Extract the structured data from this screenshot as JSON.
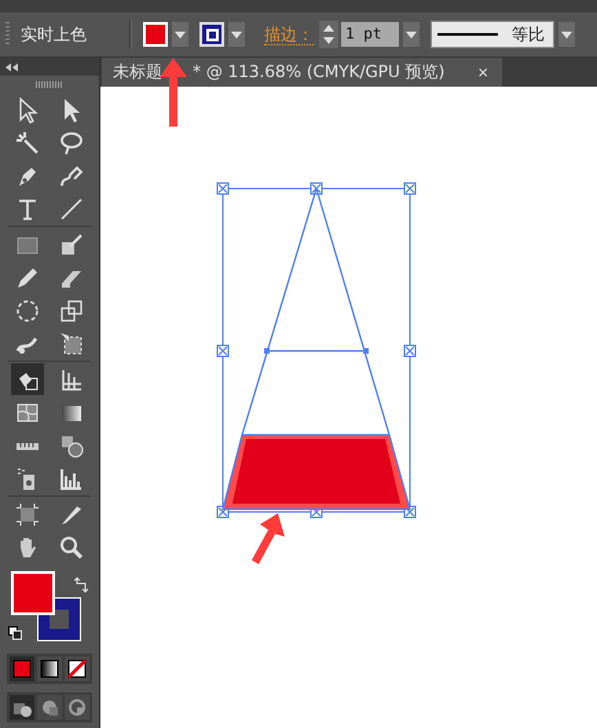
{
  "control_bar": {
    "label": "实时上色",
    "fill": {
      "color": "#e60012"
    },
    "stroke": {
      "color": "#1a1a8c"
    },
    "stroke_label": "描边：",
    "stroke_weight": "1 pt",
    "stroke_profile": "等比"
  },
  "document_tab": {
    "title_start": "未标题",
    "title_end": "* @ 113.68% (CMYK/GPU 预览)",
    "close": "×"
  },
  "tools": [
    {
      "kind": "selection",
      "selected": false
    },
    {
      "kind": "direct-selection",
      "selected": false
    },
    {
      "kind": "magic-wand",
      "selected": false
    },
    {
      "kind": "lasso",
      "selected": false
    },
    {
      "kind": "pen",
      "selected": false
    },
    {
      "kind": "curvature",
      "selected": false
    },
    {
      "kind": "type",
      "selected": false
    },
    {
      "kind": "line",
      "selected": false
    },
    {
      "kind": "rectangle",
      "selected": false
    },
    {
      "kind": "brush",
      "selected": false
    },
    {
      "kind": "pencil",
      "selected": false
    },
    {
      "kind": "eraser",
      "selected": false
    },
    {
      "kind": "rotate",
      "selected": false
    },
    {
      "kind": "scale",
      "selected": false
    },
    {
      "kind": "puppet-warp",
      "selected": false
    },
    {
      "kind": "free-transform",
      "selected": false
    },
    {
      "kind": "live-paint",
      "selected": true
    },
    {
      "kind": "perspective-grid",
      "selected": false
    },
    {
      "kind": "mesh",
      "selected": false
    },
    {
      "kind": "gradient",
      "selected": false
    },
    {
      "kind": "ruler",
      "selected": false
    },
    {
      "kind": "shapes",
      "selected": false
    },
    {
      "kind": "spray",
      "selected": false
    },
    {
      "kind": "column-graph",
      "selected": false
    },
    {
      "kind": "artboard",
      "selected": false
    },
    {
      "kind": "knife",
      "selected": false
    },
    {
      "kind": "hand",
      "selected": false
    },
    {
      "kind": "zoom",
      "selected": false
    }
  ],
  "fill_stroke": {
    "fill": {
      "color": "#e60012"
    },
    "stroke": {
      "color": "#1a1a8c"
    }
  },
  "color_modes": [
    {
      "kind": "color",
      "selected": true
    },
    {
      "kind": "gradient",
      "selected": false
    },
    {
      "kind": "none",
      "selected": false
    }
  ],
  "draw_modes": [
    {
      "kind": "normal",
      "selected": true
    },
    {
      "kind": "behind",
      "selected": false
    },
    {
      "kind": "inside",
      "selected": false
    }
  ]
}
